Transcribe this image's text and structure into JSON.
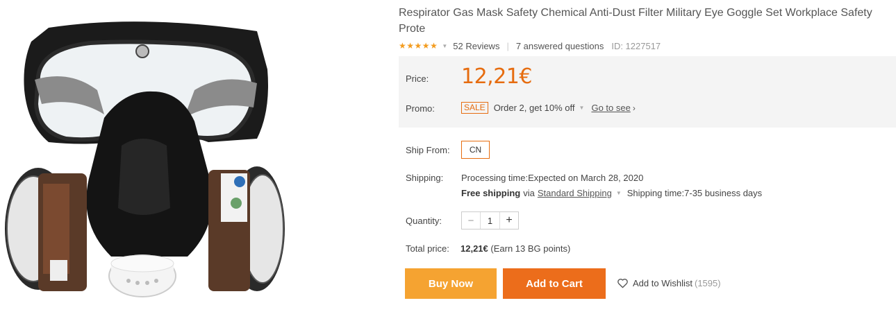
{
  "product": {
    "title": "Respirator Gas Mask Safety Chemical Anti-Dust Filter Military Eye Goggle Set Workplace Safety Prote",
    "rating_stars": 5,
    "reviews": "52 Reviews",
    "questions": "7 answered questions",
    "id": "ID: 1227517",
    "image_icon": "gas-mask-image"
  },
  "price": {
    "label": "Price:",
    "value": "12,21€",
    "promo_label": "Promo:",
    "sale_badge": "SALE",
    "promo_text": "Order 2, get 10% off",
    "goto": "Go to see",
    "goto_arrow": "›"
  },
  "shipping": {
    "ship_from_label": "Ship From:",
    "ship_from_value": "CN",
    "label": "Shipping:",
    "processing": "Processing time:Expected on March 28, 2020",
    "free": "Free shipping",
    "via": "via",
    "method": "Standard Shipping",
    "time": "Shipping time:7-35 business days"
  },
  "quantity": {
    "label": "Quantity:",
    "minus": "−",
    "value": "1",
    "plus": "+"
  },
  "total": {
    "label": "Total price:",
    "value": "12,21€",
    "points": "(Earn 13 BG points)"
  },
  "actions": {
    "buy_now": "Buy Now",
    "add_to_cart": "Add to Cart",
    "wishlist": "Add to Wishlist",
    "wishlist_count": "(1595)"
  },
  "colors": {
    "accent": "#e66c0f",
    "buy_now": "#f5a331",
    "add_to_cart": "#ec6d1b",
    "star": "#f39c1f"
  }
}
